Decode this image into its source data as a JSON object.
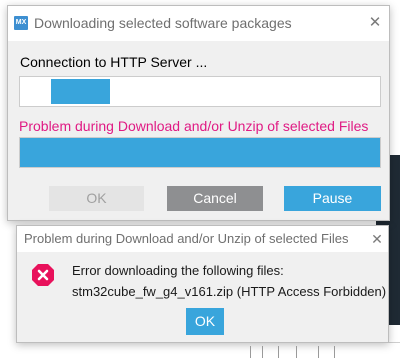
{
  "progress_dialog": {
    "title": "Downloading selected software packages",
    "app_icon": "MX",
    "close": "✕",
    "status_text": "Connection to HTTP Server ...",
    "connection_progress": {
      "start": 0.085,
      "end": 0.25
    },
    "error_text": "Problem during Download and/or Unzip of selected Files",
    "download_progress": 1.0,
    "buttons": {
      "ok": "OK",
      "cancel": "Cancel",
      "pause": "Pause"
    }
  },
  "error_dialog": {
    "title": "Problem during Download and/or Unzip of selected Files",
    "close": "✕",
    "icon": "error-icon",
    "message_line1": "Error downloading the following files:",
    "message_line2": "stm32cube_fw_g4_v161.zip (HTTP Access Forbidden)",
    "ok_label": "OK"
  },
  "colors": {
    "accent": "#39a5dc",
    "error_text": "#e01b84",
    "error_icon": "#e8115b",
    "cancel_button": "#8e8f91",
    "disabled_button": "#e4e4e4"
  }
}
